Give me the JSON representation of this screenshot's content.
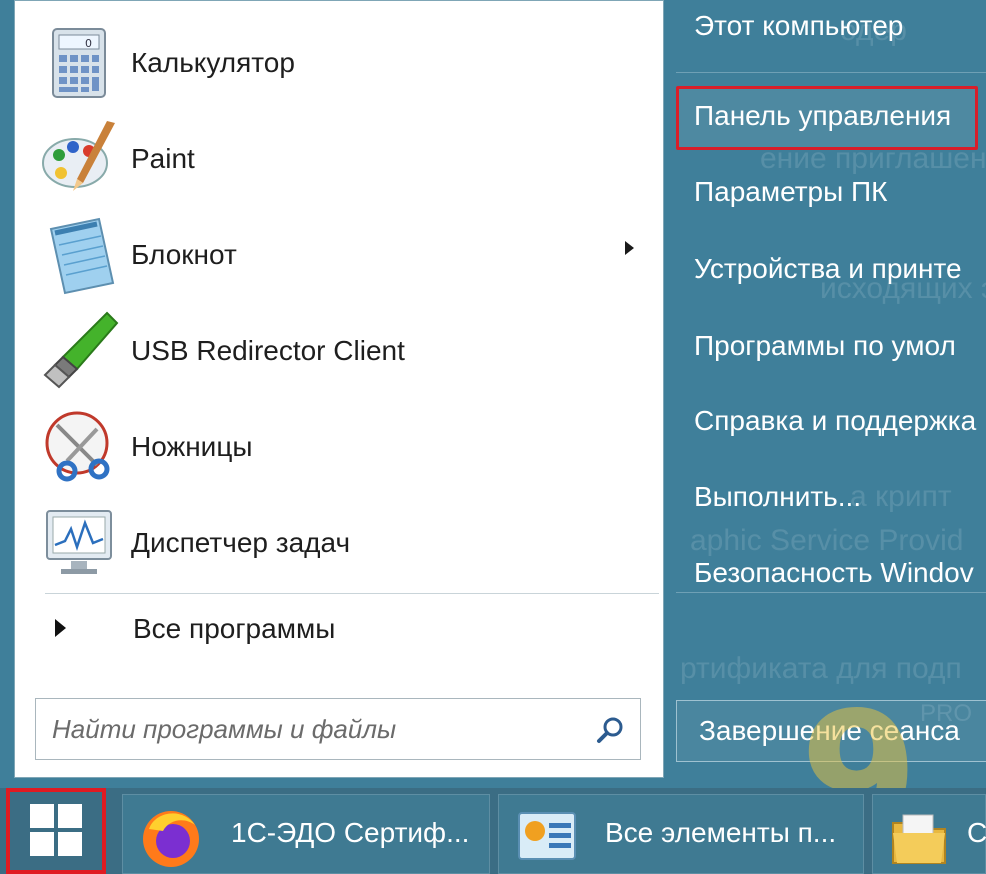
{
  "start_menu": {
    "apps": [
      {
        "label": "Калькулятор",
        "icon": "calculator-icon"
      },
      {
        "label": "Paint",
        "icon": "paint-palette-icon"
      },
      {
        "label": "Блокнот",
        "icon": "notepad-icon"
      },
      {
        "label": "USB Redirector Client",
        "icon": "usb-plug-icon"
      },
      {
        "label": "Ножницы",
        "icon": "scissors-icon"
      },
      {
        "label": "Диспетчер задач",
        "icon": "task-manager-icon"
      }
    ],
    "all_programs": "Все программы",
    "search": {
      "placeholder": "Найти программы и файлы"
    },
    "right_items": [
      "Этот компьютер",
      "Панель управления",
      "Параметры ПК",
      "Устройства и принте",
      "Программы по умол",
      "Справка и поддержка",
      "Выполнить...",
      "Безопасность Windov"
    ],
    "shutdown_label": "Завершение сеанса"
  },
  "taskbar": {
    "items": [
      {
        "label": "1С-ЭДО Сертиф...",
        "icon": "firefox-icon"
      },
      {
        "label": "Все элементы п...",
        "icon": "control-panel-icon"
      },
      {
        "label": "С",
        "icon": "folder-icon"
      }
    ]
  },
  "colors": {
    "accent": "#3f7f9a",
    "highlight_border": "#d81e2a",
    "watermark": "#ecc43c"
  }
}
